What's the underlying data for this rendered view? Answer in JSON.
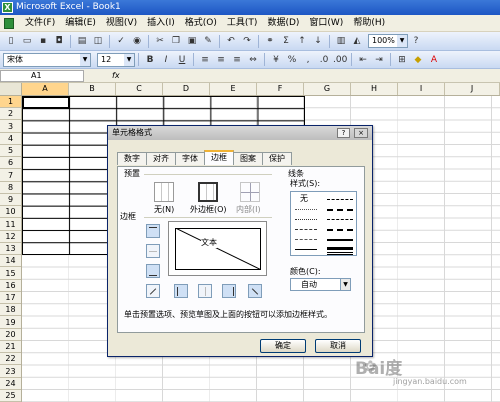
{
  "window": {
    "title": "Microsoft Excel - Book1"
  },
  "menu": [
    "文件(F)",
    "编辑(E)",
    "视图(V)",
    "插入(I)",
    "格式(O)",
    "工具(T)",
    "数据(D)",
    "窗口(W)",
    "帮助(H)"
  ],
  "toolbar": {
    "zoom": "100%",
    "font_name": "宋体",
    "font_size": "12",
    "bold": "B",
    "italic": "I",
    "underline": "U",
    "percent": "%",
    "fx": "fx"
  },
  "namebox": "A1",
  "columns": [
    "A",
    "B",
    "C",
    "D",
    "E",
    "F",
    "G",
    "H",
    "I",
    "J"
  ],
  "rows": [
    "1",
    "2",
    "3",
    "4",
    "5",
    "6",
    "7",
    "8",
    "9",
    "10",
    "11",
    "12",
    "13",
    "14",
    "15",
    "16",
    "17",
    "18",
    "19",
    "20",
    "21",
    "22",
    "23",
    "24",
    "25"
  ],
  "dialog": {
    "title": "单元格格式",
    "help": "?",
    "close": "×",
    "tabs": [
      "数字",
      "对齐",
      "字体",
      "边框",
      "图案",
      "保护"
    ],
    "active_tab": "边框",
    "preset_label": "预置",
    "presets": [
      "无(N)",
      "外边框(O)",
      "内部(I)"
    ],
    "border_label": "边框",
    "preview_text": "文本",
    "line_label": "线条",
    "style_label": "样式(S):",
    "none_style": "无",
    "color_label": "颜色(C):",
    "color_value": "自动",
    "hint": "单击预置选项、预览草图及上面的按钮可以添加边框样式。",
    "ok": "确定",
    "cancel": "取消"
  },
  "watermark": {
    "main": "Bai度",
    "sub": "jingyan.baidu.com"
  }
}
